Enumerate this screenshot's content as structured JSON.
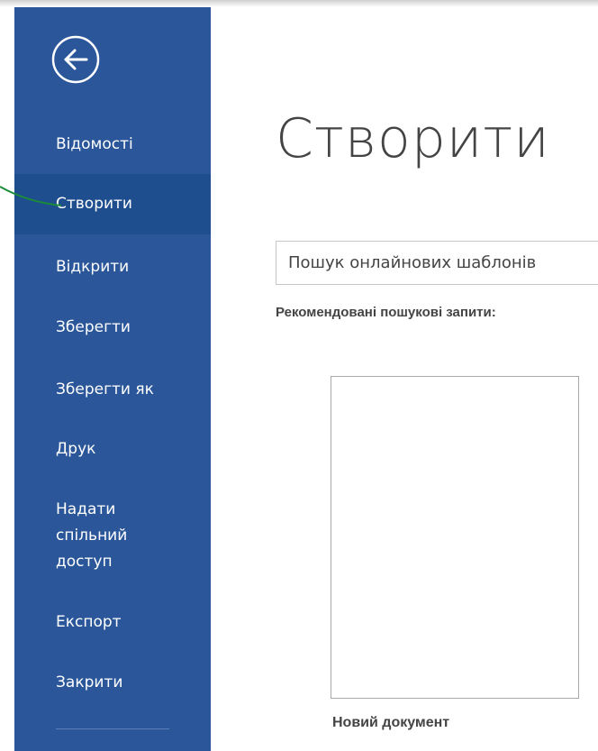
{
  "backstage": {
    "back_icon": "back-arrow-icon",
    "menu": [
      {
        "label": "Відомості",
        "active": false
      },
      {
        "label": "Створити",
        "active": true
      },
      {
        "label": "Відкрити",
        "active": false
      },
      {
        "label": "Зберегти",
        "active": false
      },
      {
        "label": "Зберегти як",
        "active": false
      },
      {
        "label": "Друк",
        "active": false
      },
      {
        "label": "Надати спільний доступ",
        "active": false
      },
      {
        "label": "Експорт",
        "active": false
      },
      {
        "label": "Закрити",
        "active": false
      }
    ]
  },
  "main": {
    "title": "Створити",
    "search": {
      "placeholder": "Пошук онлайнових шаблонів",
      "value": ""
    },
    "suggested_searches_label": "Рекомендовані пошукові запити:",
    "templates": [
      {
        "label": "Новий документ"
      }
    ]
  },
  "colors": {
    "sidebar": "#2b579a",
    "sidebar_active": "#1f4e8f",
    "pointer_line": "#1b8a3a",
    "text": "#444444"
  }
}
